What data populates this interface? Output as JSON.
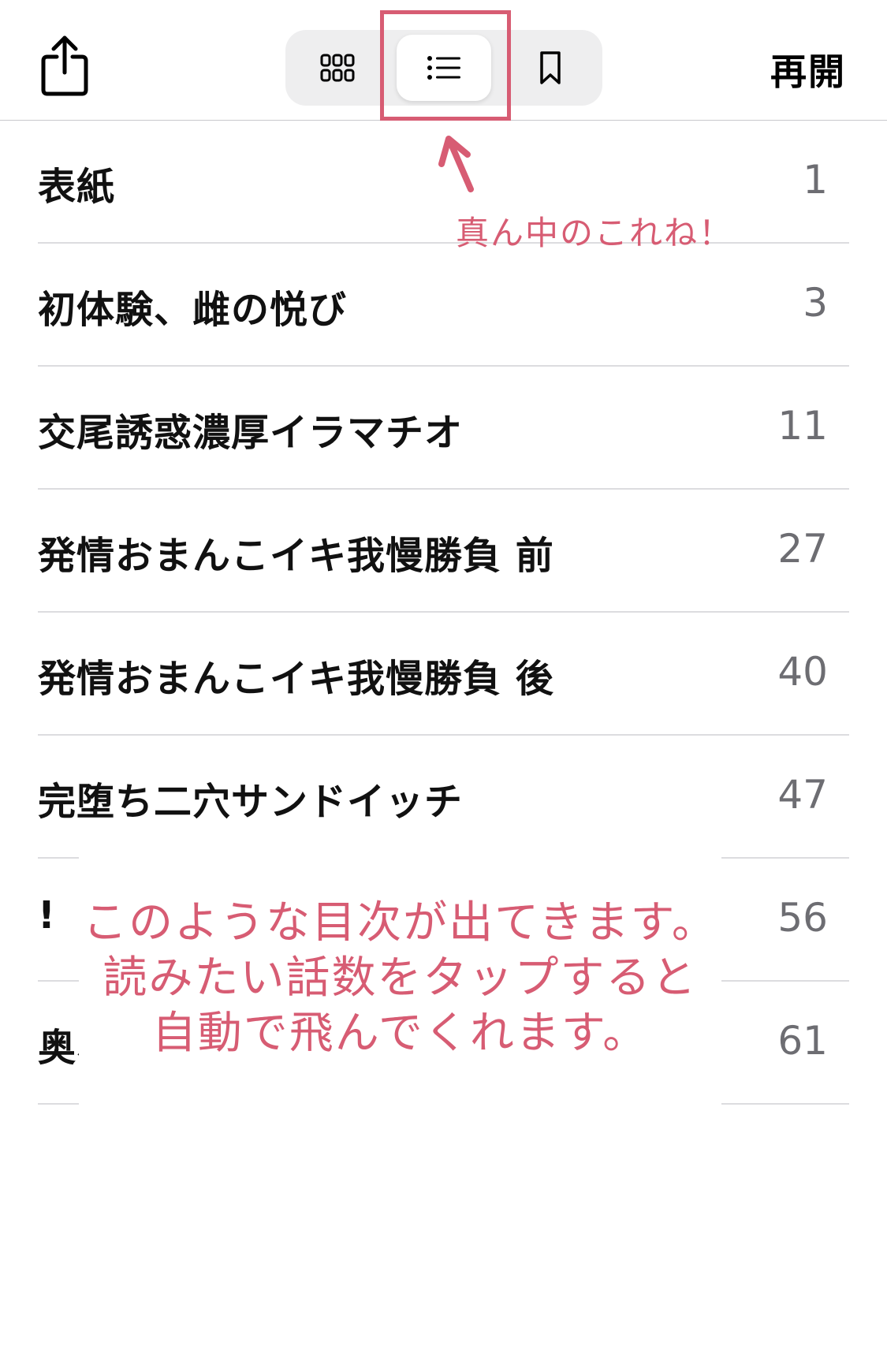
{
  "toolbar": {
    "resume_label": "再開",
    "active_segment": "list"
  },
  "toc": [
    {
      "title": "表紙",
      "page": "1"
    },
    {
      "title": "初体験、雌の悦び",
      "page": "3"
    },
    {
      "title": "交尾誘惑濃厚イラマチオ",
      "page": "11"
    },
    {
      "title": "発情おまんこイキ我慢勝負 前",
      "page": "27"
    },
    {
      "title": "発情おまんこイキ我慢勝負 後",
      "page": "40"
    },
    {
      "title": "完堕ち二穴サンドイッチ",
      "page": "47"
    },
    {
      "title": "!",
      "page": "56"
    },
    {
      "title": "奥、",
      "page": "61"
    }
  ],
  "annotations": {
    "small_note": "真ん中のこれね！",
    "big_note_lines": [
      "このような目次が出てきます。",
      "読みたい話数をタップすると",
      "自動で飛んでくれます。"
    ],
    "color": "#d75c73"
  }
}
